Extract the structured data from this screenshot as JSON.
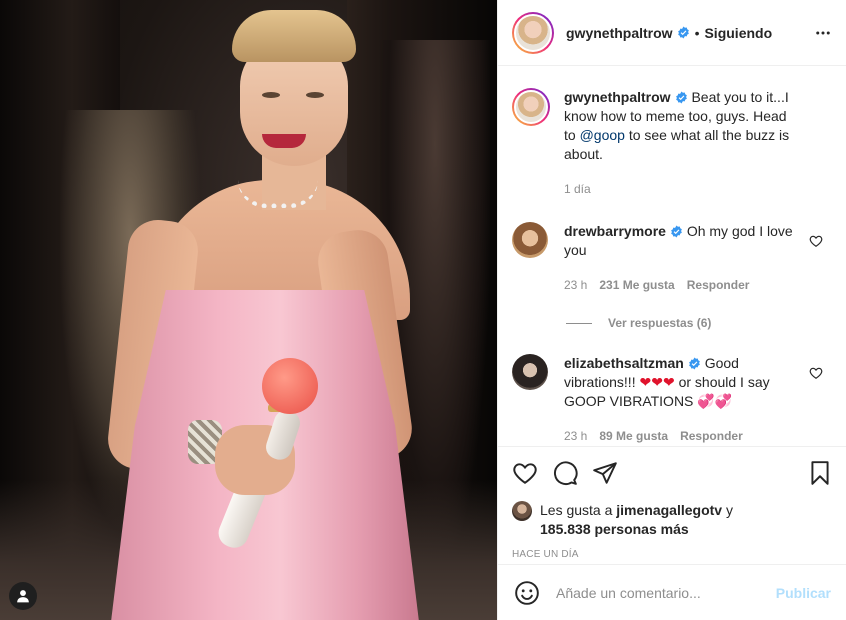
{
  "header": {
    "username": "gwynethpaltrow",
    "separator": "•",
    "follow_status": "Siguiendo",
    "more_icon": "more-horizontal-icon"
  },
  "caption": {
    "username": "gwynethpaltrow",
    "text_before": "Beat you to it...I know how to meme too, guys. Head to ",
    "mention": "@goop",
    "text_after": " to see what all the buzz is about.",
    "time": "1 día"
  },
  "comments": [
    {
      "username": "drewbarrymore",
      "text": "Oh my god I love you",
      "time": "23 h",
      "likes": "231 Me gusta",
      "reply": "Responder",
      "view_replies": "Ver respuestas (6)"
    },
    {
      "username": "elizabethsaltzman",
      "text_a": "Good vibrations!!! ",
      "emoji_a": "❤❤❤",
      "text_b": " or should I say GOOP VIBRATIONS ",
      "emoji_b": "💞💞",
      "time": "23 h",
      "likes": "89 Me gusta",
      "reply": "Responder"
    }
  ],
  "likes": {
    "prefix": "Les gusta a ",
    "user": "jimenagallegotv",
    "middle": " y",
    "count": "185.838 personas más"
  },
  "posted_time": "HACE UN DÍA",
  "comment_box": {
    "placeholder": "Añade un comentario...",
    "publish": "Publicar"
  },
  "colors": {
    "verified": "#3897f0",
    "link": "#00376b",
    "muted": "#8e8e8e",
    "publish_disabled": "#b2dffc"
  }
}
